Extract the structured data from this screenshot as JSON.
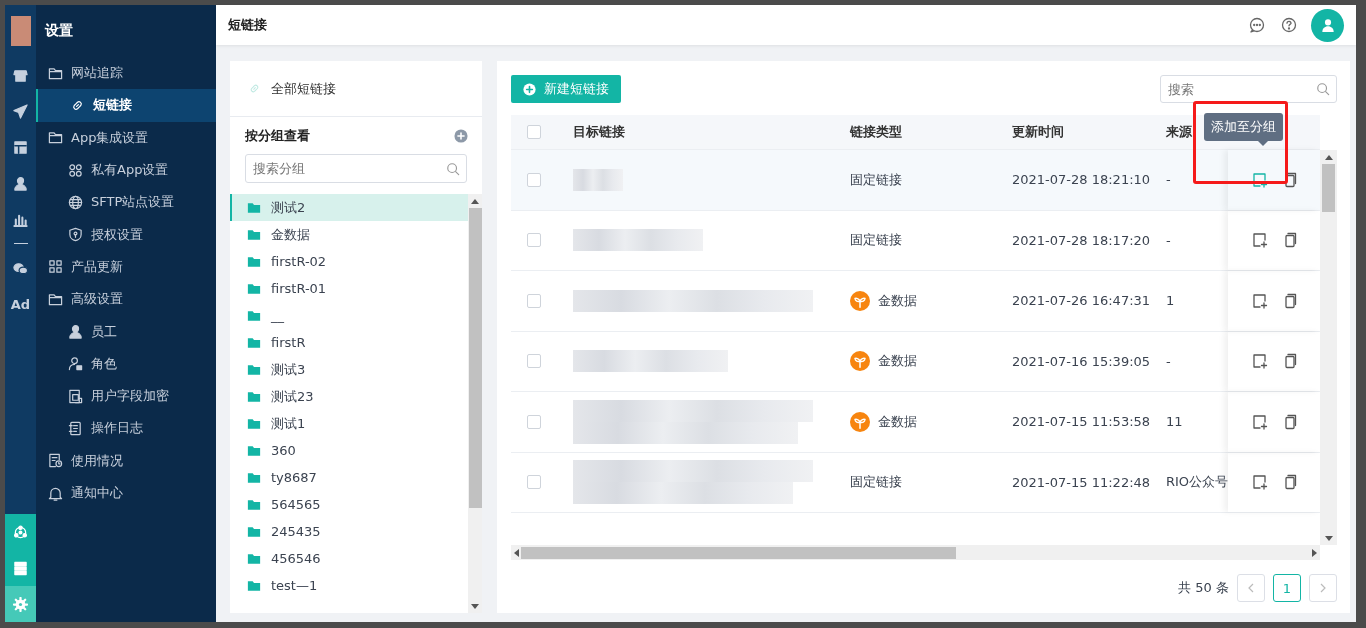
{
  "rail": {
    "items": [
      {
        "kind": "store"
      },
      {
        "kind": "send"
      },
      {
        "kind": "layout"
      },
      {
        "kind": "user"
      },
      {
        "kind": "chart"
      },
      {
        "kind": "divider"
      },
      {
        "kind": "chat"
      },
      {
        "kind": "text",
        "label": "Ad"
      }
    ],
    "bottom": [
      {
        "kind": "hub",
        "selected": false
      },
      {
        "kind": "server",
        "selected": false
      },
      {
        "kind": "gear",
        "selected": true
      }
    ]
  },
  "sidebar": {
    "title": "设置",
    "items": [
      {
        "label": "网站追踪",
        "kind": "folder",
        "selected": false,
        "children": [
          {
            "label": "短链接",
            "kind": "link",
            "selected": true
          }
        ]
      },
      {
        "label": "App集成设置",
        "kind": "folder",
        "selected": false,
        "children": [
          {
            "label": "私有App设置",
            "kind": "apps",
            "selected": false
          },
          {
            "label": "SFTP站点设置",
            "kind": "globe",
            "selected": false
          },
          {
            "label": "授权设置",
            "kind": "shield",
            "selected": false
          }
        ]
      },
      {
        "label": "产品更新",
        "kind": "grid",
        "selected": false
      },
      {
        "label": "高级设置",
        "kind": "folder",
        "selected": false,
        "children": [
          {
            "label": "员工",
            "kind": "user",
            "selected": false
          },
          {
            "label": "角色",
            "kind": "userlock",
            "selected": false
          },
          {
            "label": "用户字段加密",
            "kind": "doc",
            "selected": false
          },
          {
            "label": "操作日志",
            "kind": "log",
            "selected": false
          }
        ]
      },
      {
        "label": "使用情况",
        "kind": "report",
        "selected": false
      },
      {
        "label": "通知中心",
        "kind": "bell",
        "selected": false
      }
    ]
  },
  "header": {
    "title": "短链接"
  },
  "groups": {
    "all_label": "全部短链接",
    "heading": "按分组查看",
    "search": {
      "placeholder": "搜索分组"
    },
    "items": [
      {
        "label": "测试2",
        "selected": true
      },
      {
        "label": "金数据",
        "selected": false
      },
      {
        "label": "firstR-02",
        "selected": false
      },
      {
        "label": "firstR-01",
        "selected": false
      },
      {
        "label": "__",
        "selected": false
      },
      {
        "label": "firstR",
        "selected": false
      },
      {
        "label": "测试3",
        "selected": false
      },
      {
        "label": "测试23",
        "selected": false
      },
      {
        "label": "测试1",
        "selected": false
      },
      {
        "label": "360",
        "selected": false
      },
      {
        "label": "ty8687",
        "selected": false
      },
      {
        "label": "564565",
        "selected": false
      },
      {
        "label": "245435",
        "selected": false
      },
      {
        "label": "456546",
        "selected": false
      },
      {
        "label": "test—1",
        "selected": false
      }
    ]
  },
  "table": {
    "new_button": "新建短链接",
    "search": {
      "placeholder": "搜索"
    },
    "select_all_checked": false,
    "columns": [
      "目标链接",
      "链接类型",
      "更新时间",
      "来源"
    ],
    "rows": [
      {
        "type": {
          "kind": "fixed",
          "label": "固定链接"
        },
        "updated": "2021-07-28 18:21:10",
        "source": "-",
        "checked": false,
        "hovered": true
      },
      {
        "type": {
          "kind": "fixed",
          "label": "固定链接"
        },
        "updated": "2021-07-28 18:17:20",
        "source": "-",
        "checked": false,
        "hovered": false
      },
      {
        "type": {
          "kind": "form",
          "label": "金数据"
        },
        "updated": "2021-07-26 16:47:31",
        "source": "1",
        "checked": false,
        "hovered": false
      },
      {
        "type": {
          "kind": "form",
          "label": "金数据"
        },
        "updated": "2021-07-16 15:39:05",
        "source": "-",
        "checked": false,
        "hovered": false
      },
      {
        "type": {
          "kind": "form",
          "label": "金数据"
        },
        "updated": "2021-07-15 11:53:58",
        "source": "11",
        "checked": false,
        "hovered": false
      },
      {
        "type": {
          "kind": "fixed",
          "label": "固定链接"
        },
        "updated": "2021-07-15 11:22:48",
        "source": "RIO公众号",
        "checked": false,
        "hovered": false
      }
    ],
    "tooltip": "添加至分组",
    "total": "共 50 条",
    "pages": [
      {
        "label": "1",
        "selected": true
      }
    ]
  }
}
